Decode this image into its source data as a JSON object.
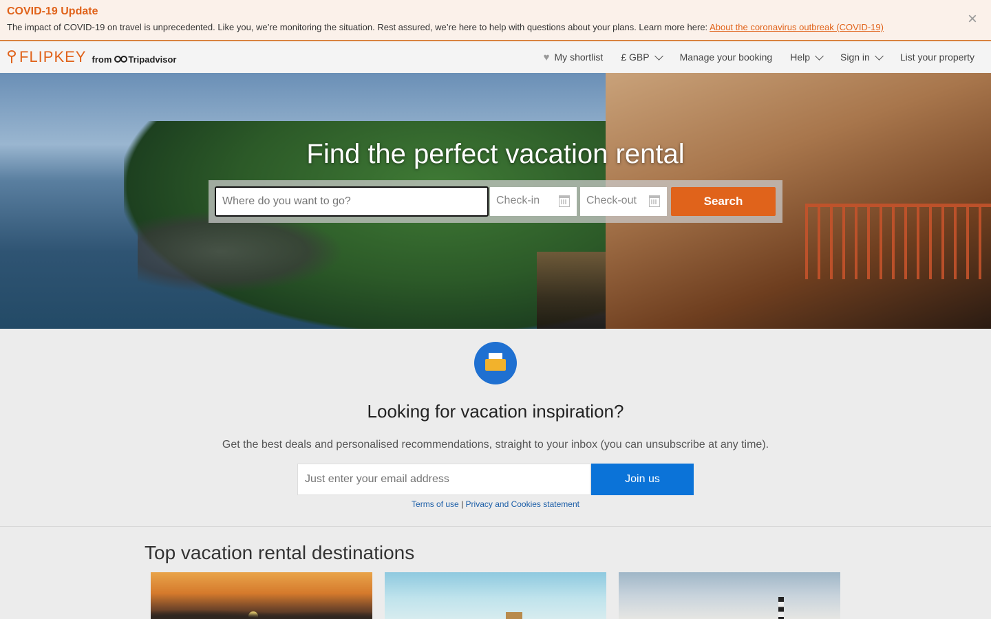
{
  "covid": {
    "title": "COVID-19 Update",
    "text": "The impact of COVID-19 on travel is unprecedented. Like you, we’re monitoring the situation. Rest assured, we’re here to help with questions about your plans. Learn more here: ",
    "link": "About the coronavirus outbreak (COVID-19)",
    "close_icon": "×"
  },
  "header": {
    "logo_text": "FLIPKEY",
    "logo_from": "from",
    "logo_partner": "Tripadvisor",
    "nav": {
      "shortlist": "My shortlist",
      "currency": "£ GBP",
      "manage": "Manage your booking",
      "help": "Help",
      "signin": "Sign in",
      "list": "List your property"
    }
  },
  "hero": {
    "title": "Find the perfect vacation rental",
    "where_placeholder": "Where do you want to go?",
    "checkin": "Check-in",
    "checkout": "Check-out",
    "search": "Search"
  },
  "newsletter": {
    "title": "Looking for vacation inspiration?",
    "text": "Get the best deals and personalised recommendations, straight to your inbox (you can unsubscribe at any time).",
    "email_placeholder": "Just enter your email address",
    "join": "Join us",
    "terms": "Terms of use",
    "separator": "|",
    "privacy": "Privacy and Cookies statement"
  },
  "destinations": {
    "title": "Top vacation rental destinations"
  },
  "colors": {
    "accent_orange": "#e0631b",
    "button_blue": "#0b73d8",
    "link_blue": "#1d5fa8"
  }
}
